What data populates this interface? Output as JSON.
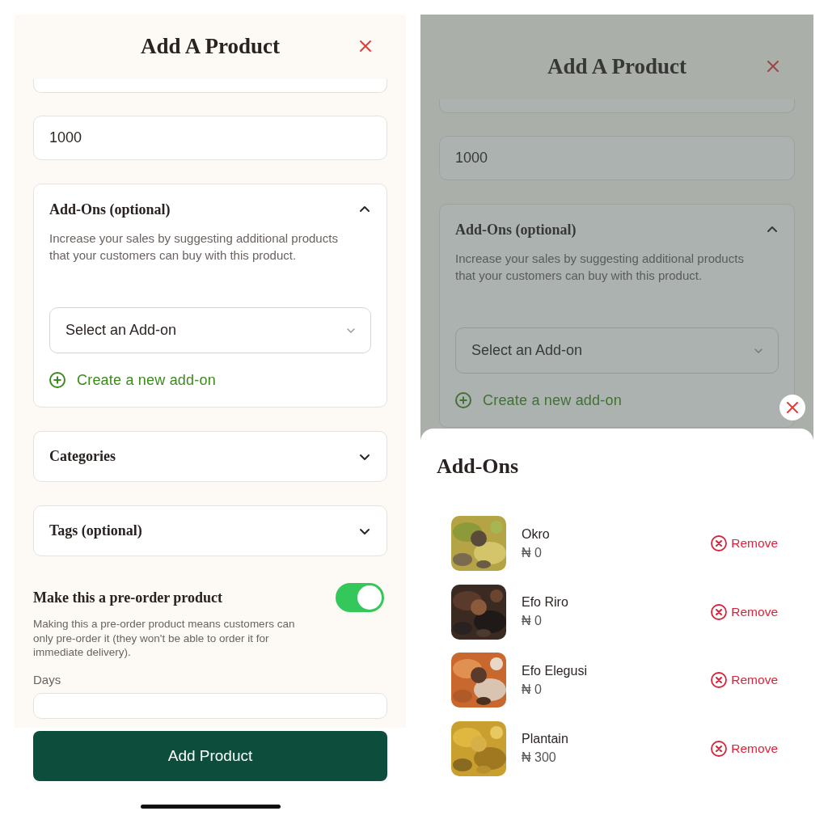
{
  "left_screen": {
    "title": "Add A Product",
    "form": {
      "price_value": "1000",
      "addons": {
        "title": "Add-Ons (optional)",
        "expanded": true,
        "description": "Increase your sales by suggesting additional products that your customers can buy with this product.",
        "select_placeholder": "Select an Add-on",
        "create_link": "Create a new add-on"
      },
      "sections": [
        {
          "title": "Categories",
          "expanded": false
        },
        {
          "title": "Tags (optional)",
          "expanded": false
        }
      ],
      "preorder": {
        "title": "Make this a pre-order product",
        "on": true,
        "description": "Making this a pre-order product means customers can only pre-order it (they won't be able to order it for immediate delivery).",
        "days_label": "Days"
      }
    },
    "submit_button": "Add Product"
  },
  "right_screen": {
    "title": "Add A Product",
    "form": {
      "price_value": "1000",
      "addons": {
        "title": "Add-Ons (optional)",
        "expanded": true,
        "description": "Increase your sales by suggesting additional products that your customers can buy with this product.",
        "select_placeholder": "Select an Add-on",
        "create_link": "Create a new add-on"
      }
    },
    "sheet": {
      "title": "Add-Ons",
      "items": [
        {
          "name": "Okro",
          "price": "₦ 0",
          "action": "Remove"
        },
        {
          "name": "Efo Riro",
          "price": "₦ 0",
          "action": "Remove"
        },
        {
          "name": "Efo Elegusi",
          "price": "₦ 0",
          "action": "Remove"
        },
        {
          "name": "Plantain",
          "price": "₦ 300",
          "action": "Remove"
        }
      ]
    }
  }
}
